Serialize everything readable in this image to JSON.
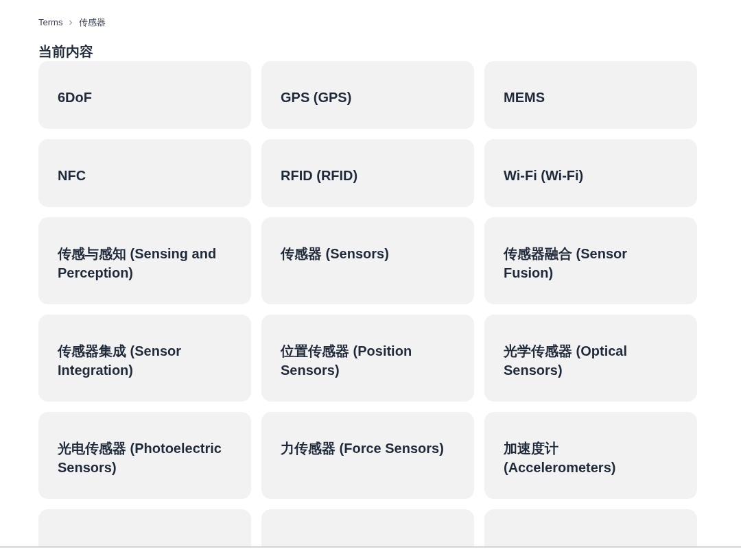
{
  "breadcrumb": [
    {
      "label": "Terms"
    },
    {
      "label": "传感器"
    }
  ],
  "heading": "当前内容",
  "cards": [
    {
      "kind": "term",
      "title": "6DoF"
    },
    {
      "kind": "term",
      "title": "GPS (GPS)"
    },
    {
      "kind": "term",
      "title": "MEMS"
    },
    {
      "kind": "term",
      "title": "NFC"
    },
    {
      "kind": "term",
      "title": "RFID (RFID)"
    },
    {
      "kind": "term",
      "title": "Wi-Fi (Wi-Fi)"
    },
    {
      "kind": "term",
      "title": "传感与感知 (Sensing and Perception)"
    },
    {
      "kind": "term",
      "title": "传感器 (Sensors)"
    },
    {
      "kind": "term",
      "title": "传感器融合 (Sensor Fusion)"
    },
    {
      "kind": "term",
      "title": "传感器集成 (Sensor Integration)"
    },
    {
      "kind": "term",
      "title": "位置传感器 (Position Sensors)"
    },
    {
      "kind": "term",
      "title": "光学传感器 (Optical Sensors)"
    },
    {
      "kind": "term",
      "title": "光电传感器 (Photoelectric Sensors)"
    },
    {
      "kind": "term",
      "title": "力传感器 (Force Sensors)"
    },
    {
      "kind": "term",
      "title": "加速度计 (Accelerometers)"
    },
    {
      "kind": "cut-off"
    },
    {
      "kind": "cut-off"
    },
    {
      "kind": "cut-off"
    }
  ]
}
